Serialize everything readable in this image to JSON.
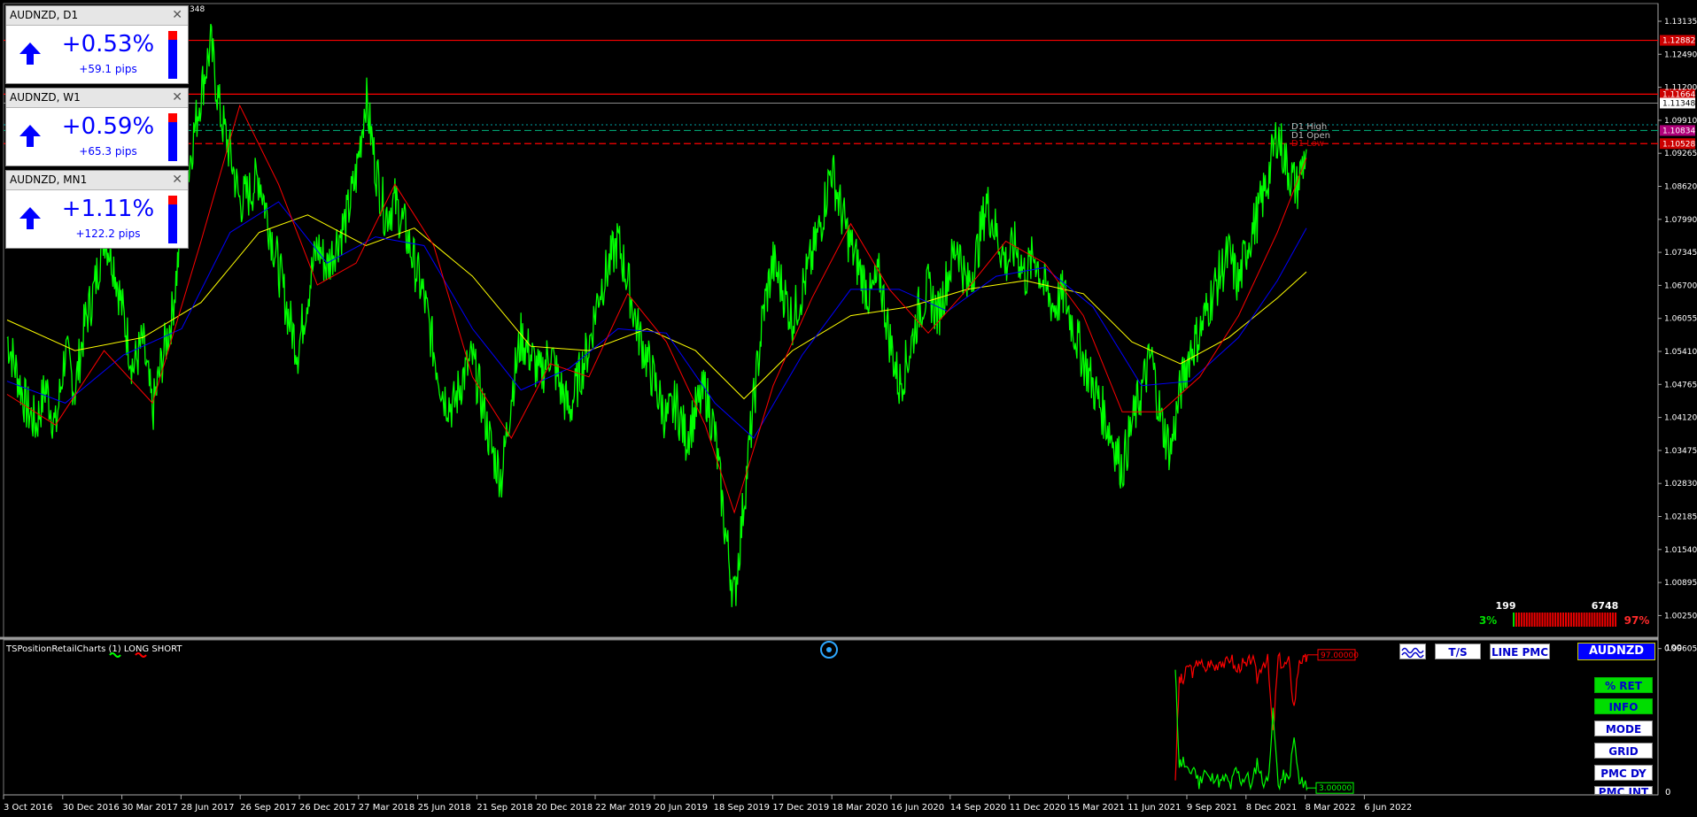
{
  "chart_data": {
    "type": "line",
    "symbol": "AUDNZD",
    "x_ticks": [
      "3 Oct 2016",
      "30 Dec 2016",
      "30 Mar 2017",
      "28 Jun 2017",
      "26 Sep 2017",
      "26 Dec 2017",
      "27 Mar 2018",
      "25 Jun 2018",
      "21 Sep 2018",
      "20 Dec 2018",
      "22 Mar 2019",
      "20 Jun 2019",
      "18 Sep 2019",
      "17 Dec 2019",
      "18 Mar 2020",
      "16 Jun 2020",
      "14 Sep 2020",
      "11 Dec 2020",
      "15 Mar 2021",
      "11 Jun 2021",
      "9 Sep 2021",
      "8 Dec 2021",
      "8 Mar 2022",
      "6 Jun 2022"
    ],
    "y_ticks": [
      "1.13135",
      "1.12490",
      "1.11200",
      "1.09910",
      "1.09265",
      "1.08620",
      "1.07990",
      "1.07345",
      "1.06700",
      "1.06055",
      "1.05410",
      "1.04765",
      "1.04120",
      "1.03475",
      "1.02830",
      "1.02185",
      "1.01540",
      "1.00895",
      "1.00250",
      "0.99605"
    ],
    "ylim": [
      0.9935,
      1.1365
    ],
    "series": [],
    "close_points": [
      [
        0,
        1.061
      ],
      [
        2,
        1.053
      ],
      [
        4,
        1.045
      ],
      [
        6,
        1.041
      ],
      [
        8,
        1.05
      ],
      [
        10,
        1.04
      ],
      [
        12,
        1.058
      ],
      [
        14,
        1.049
      ],
      [
        16,
        1.064
      ],
      [
        18,
        1.072
      ],
      [
        20,
        1.085
      ],
      [
        22,
        1.078
      ],
      [
        24,
        1.066
      ],
      [
        26,
        1.054
      ],
      [
        28,
        1.06
      ],
      [
        30,
        1.044
      ],
      [
        32,
        1.056
      ],
      [
        34,
        1.066
      ],
      [
        36,
        1.086
      ],
      [
        38,
        1.104
      ],
      [
        40,
        1.117
      ],
      [
        42,
        1.128
      ],
      [
        44,
        1.112
      ],
      [
        46,
        1.103
      ],
      [
        48,
        1.092
      ],
      [
        50,
        1.094
      ],
      [
        52,
        1.098
      ],
      [
        54,
        1.087
      ],
      [
        56,
        1.077
      ],
      [
        58,
        1.066
      ],
      [
        60,
        1.058
      ],
      [
        62,
        1.071
      ],
      [
        64,
        1.082
      ],
      [
        66,
        1.077
      ],
      [
        68,
        1.083
      ],
      [
        70,
        1.088
      ],
      [
        72,
        1.098
      ],
      [
        74,
        1.116
      ],
      [
        76,
        1.1
      ],
      [
        78,
        1.089
      ],
      [
        80,
        1.092
      ],
      [
        82,
        1.086
      ],
      [
        84,
        1.078
      ],
      [
        86,
        1.07
      ],
      [
        88,
        1.058
      ],
      [
        90,
        1.048
      ],
      [
        92,
        1.045
      ],
      [
        94,
        1.052
      ],
      [
        96,
        1.056
      ],
      [
        98,
        1.046
      ],
      [
        100,
        1.035
      ],
      [
        102,
        1.029
      ],
      [
        104,
        1.048
      ],
      [
        106,
        1.061
      ],
      [
        108,
        1.057
      ],
      [
        110,
        1.052
      ],
      [
        112,
        1.058
      ],
      [
        114,
        1.05
      ],
      [
        116,
        1.044
      ],
      [
        118,
        1.052
      ],
      [
        120,
        1.059
      ],
      [
        122,
        1.071
      ],
      [
        124,
        1.077
      ],
      [
        126,
        1.083
      ],
      [
        128,
        1.074
      ],
      [
        130,
        1.063
      ],
      [
        132,
        1.056
      ],
      [
        134,
        1.049
      ],
      [
        136,
        1.042
      ],
      [
        138,
        1.046
      ],
      [
        140,
        1.038
      ],
      [
        142,
        1.044
      ],
      [
        144,
        1.049
      ],
      [
        146,
        1.039
      ],
      [
        148,
        1.018
      ],
      [
        150,
        1.001
      ],
      [
        152,
        1.024
      ],
      [
        154,
        1.046
      ],
      [
        156,
        1.067
      ],
      [
        158,
        1.078
      ],
      [
        160,
        1.072
      ],
      [
        162,
        1.065
      ],
      [
        164,
        1.072
      ],
      [
        166,
        1.079
      ],
      [
        168,
        1.088
      ],
      [
        170,
        1.1
      ],
      [
        172,
        1.09
      ],
      [
        174,
        1.082
      ],
      [
        176,
        1.076
      ],
      [
        178,
        1.07
      ],
      [
        180,
        1.075
      ],
      [
        182,
        1.061
      ],
      [
        184,
        1.05
      ],
      [
        186,
        1.057
      ],
      [
        188,
        1.067
      ],
      [
        190,
        1.072
      ],
      [
        192,
        1.066
      ],
      [
        194,
        1.075
      ],
      [
        196,
        1.083
      ],
      [
        198,
        1.072
      ],
      [
        200,
        1.08
      ],
      [
        202,
        1.092
      ],
      [
        204,
        1.085
      ],
      [
        206,
        1.078
      ],
      [
        208,
        1.082
      ],
      [
        210,
        1.075
      ],
      [
        212,
        1.08
      ],
      [
        214,
        1.072
      ],
      [
        216,
        1.068
      ],
      [
        218,
        1.071
      ],
      [
        220,
        1.063
      ],
      [
        222,
        1.056
      ],
      [
        224,
        1.05
      ],
      [
        226,
        1.044
      ],
      [
        228,
        1.038
      ],
      [
        230,
        1.031
      ],
      [
        232,
        1.041
      ],
      [
        234,
        1.049
      ],
      [
        236,
        1.057
      ],
      [
        238,
        1.042
      ],
      [
        240,
        1.035
      ],
      [
        242,
        1.049
      ],
      [
        244,
        1.058
      ],
      [
        246,
        1.062
      ],
      [
        248,
        1.069
      ],
      [
        250,
        1.075
      ],
      [
        252,
        1.08
      ],
      [
        254,
        1.073
      ],
      [
        256,
        1.083
      ],
      [
        258,
        1.089
      ],
      [
        260,
        1.097
      ],
      [
        262,
        1.108
      ],
      [
        264,
        1.1
      ],
      [
        266,
        1.095
      ],
      [
        268,
        1.104
      ]
    ],
    "close_range": [
      0,
      268
    ],
    "ema_fast_points": [
      [
        0,
        1.048
      ],
      [
        10,
        1.041
      ],
      [
        20,
        1.058
      ],
      [
        30,
        1.046
      ],
      [
        40,
        1.083
      ],
      [
        48,
        1.114
      ],
      [
        56,
        1.096
      ],
      [
        64,
        1.073
      ],
      [
        72,
        1.078
      ],
      [
        80,
        1.096
      ],
      [
        88,
        1.082
      ],
      [
        96,
        1.052
      ],
      [
        104,
        1.038
      ],
      [
        112,
        1.055
      ],
      [
        120,
        1.052
      ],
      [
        128,
        1.071
      ],
      [
        136,
        1.06
      ],
      [
        144,
        1.041
      ],
      [
        150,
        1.021
      ],
      [
        158,
        1.05
      ],
      [
        166,
        1.07
      ],
      [
        174,
        1.087
      ],
      [
        182,
        1.072
      ],
      [
        190,
        1.062
      ],
      [
        198,
        1.072
      ],
      [
        206,
        1.083
      ],
      [
        214,
        1.078
      ],
      [
        222,
        1.066
      ],
      [
        230,
        1.044
      ],
      [
        238,
        1.044
      ],
      [
        246,
        1.052
      ],
      [
        254,
        1.066
      ],
      [
        262,
        1.085
      ],
      [
        268,
        1.102
      ]
    ],
    "ema_mid_points": [
      [
        0,
        1.051
      ],
      [
        12,
        1.046
      ],
      [
        24,
        1.057
      ],
      [
        36,
        1.063
      ],
      [
        46,
        1.085
      ],
      [
        56,
        1.092
      ],
      [
        66,
        1.078
      ],
      [
        76,
        1.084
      ],
      [
        86,
        1.082
      ],
      [
        96,
        1.063
      ],
      [
        106,
        1.049
      ],
      [
        116,
        1.054
      ],
      [
        126,
        1.063
      ],
      [
        136,
        1.062
      ],
      [
        146,
        1.046
      ],
      [
        154,
        1.038
      ],
      [
        164,
        1.057
      ],
      [
        174,
        1.072
      ],
      [
        184,
        1.072
      ],
      [
        194,
        1.067
      ],
      [
        204,
        1.075
      ],
      [
        214,
        1.077
      ],
      [
        224,
        1.068
      ],
      [
        234,
        1.05
      ],
      [
        244,
        1.051
      ],
      [
        254,
        1.061
      ],
      [
        262,
        1.074
      ],
      [
        268,
        1.086
      ]
    ],
    "ema_slow_points": [
      [
        0,
        1.065
      ],
      [
        14,
        1.058
      ],
      [
        28,
        1.061
      ],
      [
        40,
        1.069
      ],
      [
        52,
        1.085
      ],
      [
        62,
        1.089
      ],
      [
        74,
        1.082
      ],
      [
        84,
        1.086
      ],
      [
        96,
        1.075
      ],
      [
        108,
        1.059
      ],
      [
        120,
        1.058
      ],
      [
        132,
        1.063
      ],
      [
        142,
        1.058
      ],
      [
        152,
        1.047
      ],
      [
        162,
        1.058
      ],
      [
        174,
        1.066
      ],
      [
        186,
        1.068
      ],
      [
        198,
        1.072
      ],
      [
        210,
        1.074
      ],
      [
        222,
        1.071
      ],
      [
        232,
        1.06
      ],
      [
        242,
        1.055
      ],
      [
        252,
        1.061
      ],
      [
        262,
        1.07
      ],
      [
        268,
        1.076
      ]
    ],
    "bid_label": "1.11348",
    "price_tags": [
      {
        "text": "1.12882",
        "value": 1.1289,
        "color": "#cc0000"
      },
      {
        "text": "1.11664",
        "value": 1.1166,
        "color": "#cc0000"
      },
      {
        "text": "1.10834",
        "value": 1.1083,
        "color": "#b0007a"
      },
      {
        "text": "1.10528",
        "value": 1.1053,
        "color": "#cc0000"
      }
    ],
    "level_labels": [
      {
        "text": "D1 High",
        "value": 1.1075,
        "color": "#bbbbbb"
      },
      {
        "text": "D1 Open",
        "value": 1.1062,
        "color": "#bbbbbb"
      },
      {
        "text": "D1 Low",
        "value": 1.1049,
        "color": "#cc0000"
      }
    ],
    "corner_text": "348",
    "ratio": {
      "count_left": "199",
      "count_right": "6748",
      "pct_left": "3%",
      "pct_right": "97%"
    },
    "indicator": {
      "label": "TSPositionRetailCharts (1) LONG SHORT",
      "max_label": "100",
      "min_label": "0",
      "short_tag": "97.00000",
      "long_tag": "3.00000",
      "short_value": 97,
      "long_value": 3,
      "short_points": [
        [
          0,
          10
        ],
        [
          3,
          80
        ],
        [
          6,
          78
        ],
        [
          10,
          90
        ],
        [
          14,
          84
        ],
        [
          18,
          95
        ],
        [
          22,
          85
        ],
        [
          26,
          92
        ],
        [
          30,
          88
        ],
        [
          34,
          94
        ],
        [
          38,
          90
        ],
        [
          42,
          96
        ],
        [
          46,
          85
        ],
        [
          50,
          91
        ],
        [
          54,
          88
        ],
        [
          58,
          96
        ],
        [
          62,
          80
        ],
        [
          66,
          92
        ],
        [
          70,
          93
        ],
        [
          74,
          40
        ],
        [
          78,
          95
        ],
        [
          82,
          89
        ],
        [
          86,
          92
        ],
        [
          90,
          60
        ],
        [
          94,
          95
        ],
        [
          98,
          92
        ],
        [
          100,
          97
        ]
      ],
      "long_points": [
        [
          0,
          85
        ],
        [
          3,
          20
        ],
        [
          6,
          22
        ],
        [
          10,
          12
        ],
        [
          14,
          18
        ],
        [
          18,
          6
        ],
        [
          22,
          16
        ],
        [
          26,
          8
        ],
        [
          30,
          12
        ],
        [
          34,
          6
        ],
        [
          38,
          10
        ],
        [
          42,
          4
        ],
        [
          46,
          16
        ],
        [
          50,
          8
        ],
        [
          54,
          12
        ],
        [
          58,
          4
        ],
        [
          62,
          22
        ],
        [
          66,
          8
        ],
        [
          70,
          7
        ],
        [
          74,
          55
        ],
        [
          78,
          5
        ],
        [
          82,
          11
        ],
        [
          86,
          8
        ],
        [
          90,
          38
        ],
        [
          94,
          5
        ],
        [
          98,
          8
        ],
        [
          100,
          3
        ]
      ]
    }
  },
  "panels": [
    {
      "title": "AUDNZD, D1",
      "pct": "+0.53%",
      "pips": "+59.1 pips"
    },
    {
      "title": "AUDNZD, W1",
      "pct": "+0.59%",
      "pips": "+65.3 pips"
    },
    {
      "title": "AUDNZD, MN1",
      "pct": "+1.11%",
      "pips": "+122.2 pips"
    }
  ],
  "buttons": {
    "ts": "T/S",
    "line_pmc": "LINE PMC",
    "symbol": "AUDNZD",
    "ret": "% RET",
    "info": "INFO",
    "mode": "MODE",
    "grid": "GRID",
    "pmc_dy": "PMC DY",
    "pmc_int": "PMC INT"
  },
  "colors": {
    "price": "#00ff00",
    "ema_fast": "#ff0000",
    "ema_mid": "#0000ff",
    "ema_slow": "#ffff00",
    "panel_text": "#0000ff"
  },
  "icons": {
    "wave_button": "wave-icon",
    "target": "target-icon",
    "up_arrow": "arrow-up-icon"
  }
}
